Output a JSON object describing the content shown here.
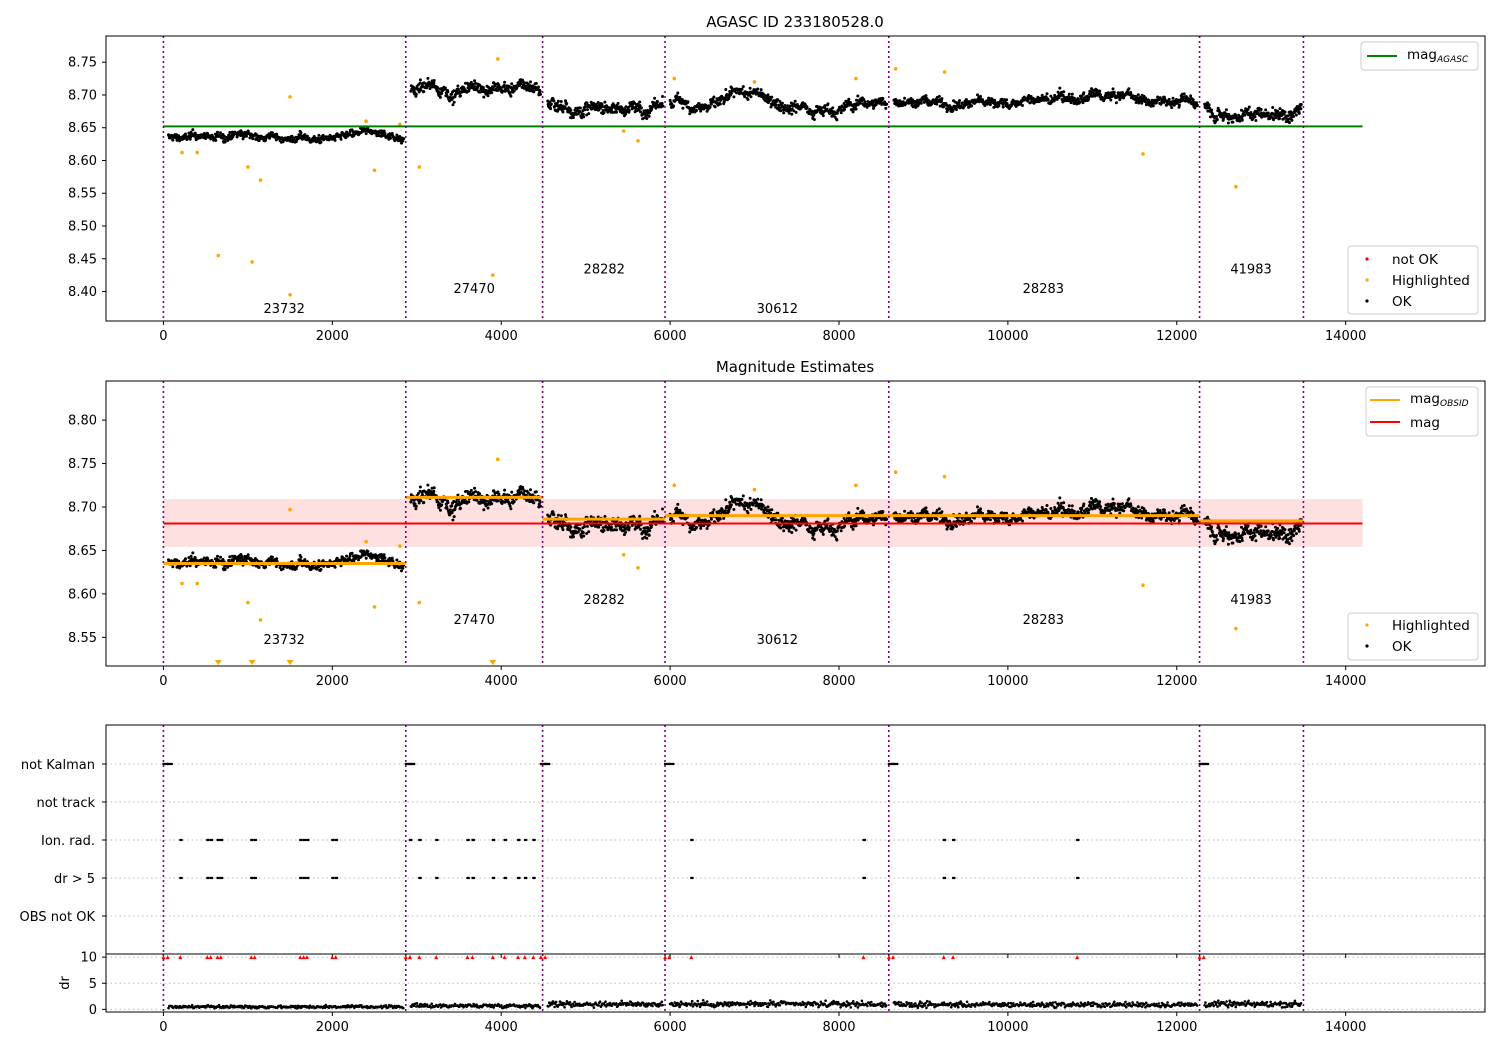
{
  "chart_data": [
    {
      "type": "scatter",
      "title": "AGASC ID 233180528.0",
      "xlim": [
        -680,
        15650
      ],
      "ylim": [
        8.355,
        8.79
      ],
      "x_ticks": [
        "0",
        "2000",
        "4000",
        "6000",
        "8000",
        "10000",
        "12000",
        "14000"
      ],
      "y_ticks": [
        "8.40",
        "8.45",
        "8.50",
        "8.55",
        "8.60",
        "8.65",
        "8.70",
        "8.75"
      ],
      "obs_boundaries": [
        0,
        2870,
        4490,
        5940,
        8590,
        12270,
        13500
      ],
      "obs_labels": [
        {
          "text": "23732",
          "x": 1430,
          "y": 8.375
        },
        {
          "text": "27470",
          "x": 3680,
          "y": 8.405
        },
        {
          "text": "28282",
          "x": 5220,
          "y": 8.435
        },
        {
          "text": "30612",
          "x": 7270,
          "y": 8.375
        },
        {
          "text": "28283",
          "x": 10420,
          "y": 8.405
        },
        {
          "text": "41983",
          "x": 12880,
          "y": 8.435
        }
      ],
      "segments": [
        {
          "x0": 0,
          "x1": 2870,
          "y": 8.635,
          "noise": 0.012
        },
        {
          "x0": 2870,
          "x1": 4490,
          "y": 8.71,
          "noise": 0.02
        },
        {
          "x0": 4490,
          "x1": 5940,
          "y": 8.685,
          "noise": 0.02
        },
        {
          "x0": 5940,
          "x1": 8590,
          "y": 8.69,
          "noise": 0.018
        },
        {
          "x0": 8590,
          "x1": 12270,
          "y": 8.69,
          "noise": 0.016
        },
        {
          "x0": 12270,
          "x1": 13500,
          "y": 8.685,
          "noise": 0.02
        }
      ],
      "highlighted": [
        [
          650,
          8.455
        ],
        [
          1050,
          8.445
        ],
        [
          1500,
          8.395
        ],
        [
          3900,
          8.425
        ],
        [
          1000,
          8.59
        ],
        [
          1150,
          8.57
        ],
        [
          2500,
          8.585
        ],
        [
          3030,
          8.59
        ],
        [
          5620,
          8.63
        ],
        [
          11600,
          8.61
        ],
        [
          12700,
          8.56
        ],
        [
          1500,
          8.697
        ],
        [
          220,
          8.612
        ],
        [
          400,
          8.612
        ],
        [
          3960,
          8.755
        ],
        [
          8200,
          8.725
        ],
        [
          8670,
          8.74
        ],
        [
          9250,
          8.735
        ],
        [
          6050,
          8.725
        ],
        [
          7000,
          8.72
        ],
        [
          5450,
          8.645
        ],
        [
          2800,
          8.655
        ],
        [
          2400,
          8.66
        ]
      ],
      "agasc_mag": {
        "value": 8.652,
        "x0": 0,
        "x1": 14200
      },
      "series": [
        {
          "name": "mag$_{AGASC}$",
          "color": "#008000"
        },
        {
          "name": "not OK",
          "color": "#ff0000"
        },
        {
          "name": "Highlighted",
          "color": "#ffa500"
        },
        {
          "name": "OK",
          "color": "#000000"
        }
      ],
      "legend_top": [
        "mag",
        "AGASC"
      ],
      "legend_bottom": [
        "not OK",
        "Highlighted",
        "OK"
      ]
    },
    {
      "type": "scatter",
      "title": "Magnitude Estimates",
      "xlim": [
        -680,
        15650
      ],
      "ylim": [
        8.517,
        8.845
      ],
      "x_ticks": [
        "0",
        "2000",
        "4000",
        "6000",
        "8000",
        "10000",
        "12000",
        "14000"
      ],
      "y_ticks": [
        "8.55",
        "8.60",
        "8.65",
        "8.70",
        "8.75",
        "8.80"
      ],
      "obs_labels": [
        {
          "text": "23732",
          "x": 1430,
          "y": 8.548
        },
        {
          "text": "27470",
          "x": 3680,
          "y": 8.571
        },
        {
          "text": "28282",
          "x": 5220,
          "y": 8.594
        },
        {
          "text": "30612",
          "x": 7270,
          "y": 8.548
        },
        {
          "text": "28283",
          "x": 10420,
          "y": 8.571
        },
        {
          "text": "41983",
          "x": 12880,
          "y": 8.594
        }
      ],
      "mag": {
        "value": 8.681,
        "band": [
          8.654,
          8.709
        ],
        "x0": 0,
        "x1": 14200
      },
      "mag_obsid": [
        {
          "x0": 0,
          "x1": 2870,
          "y": 8.635
        },
        {
          "x0": 2870,
          "x1": 4490,
          "y": 8.711
        },
        {
          "x0": 4490,
          "x1": 5940,
          "y": 8.686
        },
        {
          "x0": 5940,
          "x1": 8590,
          "y": 8.69
        },
        {
          "x0": 8590,
          "x1": 12270,
          "y": 8.69
        },
        {
          "x0": 12270,
          "x1": 13500,
          "y": 8.684
        }
      ],
      "legend_top": [
        "mag",
        "OBSID",
        "mag"
      ],
      "legend_bottom": [
        "Highlighted",
        "OK"
      ]
    },
    {
      "type": "scatter",
      "title": "",
      "xlim": [
        -680,
        15650
      ],
      "categories": [
        "not Kalman",
        "not track",
        "Ion. rad.",
        "dr > 5",
        "OBS not OK"
      ],
      "x_ticks": [
        "0",
        "2000",
        "4000",
        "6000",
        "8000",
        "10000",
        "12000",
        "14000"
      ],
      "flag_clusters": {
        "not Kalman": [
          0,
          50,
          2870,
          2920,
          4470,
          4520,
          5940,
          5990,
          8590,
          8640,
          12270,
          12320
        ],
        "Ion. rad.": [
          200,
          520,
          560,
          640,
          680,
          1040,
          1080,
          1620,
          1660,
          1700,
          2000,
          2040,
          2920,
          3030,
          3230,
          3600,
          3660,
          3900,
          4040,
          4200,
          4280,
          4380,
          6250,
          8290,
          9240,
          9350,
          10820
        ],
        "dr > 5": [
          200,
          520,
          560,
          640,
          680,
          1040,
          1080,
          1620,
          1660,
          1700,
          2000,
          2040,
          3030,
          3230,
          3600,
          3660,
          3900,
          4040,
          4200,
          4280,
          4380,
          6250,
          8290,
          9240,
          9350,
          10820
        ]
      },
      "dr_ticks": [
        "0",
        "5",
        "10"
      ],
      "dr_ylim": [
        -0.5,
        10.6
      ],
      "dr_segments": [
        {
          "x0": 0,
          "x1": 2870,
          "y": 0.5
        },
        {
          "x0": 2870,
          "x1": 4490,
          "y": 0.7
        },
        {
          "x0": 4490,
          "x1": 5940,
          "y": 1.0
        },
        {
          "x0": 5940,
          "x1": 8590,
          "y": 1.0
        },
        {
          "x0": 8590,
          "x1": 12270,
          "y": 0.9
        },
        {
          "x0": 12270,
          "x1": 13500,
          "y": 1.0
        }
      ],
      "ylabel": "dr"
    }
  ]
}
